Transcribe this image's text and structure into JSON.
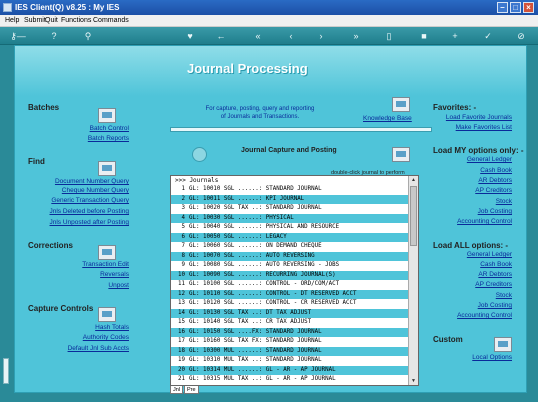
{
  "window": {
    "title": "IES Client(Q) v8.25 : My IES"
  },
  "menu": [
    "Help",
    "Submit",
    "Quit",
    "Functions",
    "Commands"
  ],
  "toolbar_icons": [
    "key-icon",
    "help-icon",
    "search-icon",
    "heart-icon",
    "back-icon",
    "first-icon",
    "prev-icon",
    "next-icon",
    "last-icon",
    "page-icon",
    "stop-icon",
    "add-icon",
    "ok-icon",
    "cancel-icon"
  ],
  "page": {
    "heading": "Journal Processing"
  },
  "batches": {
    "title": "Batches",
    "links": [
      "Batch Control",
      "Batch Reports"
    ]
  },
  "find": {
    "title": "Find",
    "links": [
      "Document Number Query",
      "Cheque Number Query",
      "Generic Transaction Query",
      "Jnls Deleted before Posting",
      "Jnls Unposted after Posting"
    ]
  },
  "corrections": {
    "title": "Corrections",
    "links": [
      "Transaction Edit",
      "Reversals",
      "Unpost"
    ]
  },
  "capture_controls": {
    "title": "Capture Controls",
    "links": [
      "Hash Totals",
      "Authority Codes",
      "Default Jnl Sub Accts"
    ]
  },
  "center": {
    "description_line1": "For capture, posting, query and reporting",
    "description_line2": "of Journals and Transactions.",
    "knowledge_base": "Knowledge Base",
    "capture_title": "Journal Capture and Posting",
    "capture_hint": "double-click journal to perform"
  },
  "journals": {
    "header": ">>> Journals",
    "rows": [
      "GL: 10010 SGL ......: STANDARD JOURNAL",
      "GL: 10011 SGL ......: KPI JOURNAL",
      "GL: 10020 SGL TAX ..: STANDARD JOURNAL",
      "GL: 10030 SGL ......: PHYSICAL",
      "GL: 10040 SGL ......: PHYSICAL AND RESOURCE",
      "GL: 10050 SGL ......: LEGACY",
      "GL: 10060 SGL ......: ON DEMAND CHEQUE",
      "GL: 10070 SGL ......: AUTO REVERSING",
      "GL: 10080 SGL ......: AUTO REVERSING - JOBS",
      "GL: 10090 SGL ......: RECURRING JOURNAL(S)",
      "GL: 10100 SGL ......: CONTROL - ORD/COM/ACT",
      "GL: 10110 SGL ......: CONTROL - DT RESERVED ACCT",
      "GL: 10120 SGL ......: CONTROL - CR RESERVED ACCT",
      "GL: 10130 SGL TAX ..: DT TAX ADJUST",
      "GL: 10140 SGL TAX ..: CR TAX ADJUST",
      "GL: 10150 SGL ....FX: STANDARD JOURNAL",
      "GL: 10160 SGL TAX FX: STANDARD JOURNAL",
      "GL: 10300 MUL ......: STANDARD JOURNAL",
      "GL: 10310 MUL TAX ..: STANDARD JOURNAL",
      "GL: 10314 MUL ......: GL - AR - AP JOURNAL",
      "GL: 10315 MUL TAX ..: GL - AR - AP JOURNAL"
    ],
    "tabs": [
      "Jnl",
      "Pre"
    ]
  },
  "favorites": {
    "title": "Favorites: -",
    "links": [
      "Load Favorite Journals",
      "Make Favorites List"
    ]
  },
  "my_options": {
    "title": "Load MY options only: -",
    "links": [
      "General Ledger",
      "Cash Book",
      "AR Debtors",
      "AP Creditors",
      "Stock",
      "Job Costing",
      "Accounting Control"
    ]
  },
  "all_options": {
    "title": "Load ALL options: -",
    "links": [
      "General Ledger",
      "Cash Book",
      "AR Debtors",
      "AP Creditors",
      "Stock",
      "Job Costing",
      "Accounting Control"
    ]
  },
  "custom": {
    "title": "Custom",
    "links": [
      "Local Options"
    ]
  },
  "colors": {
    "background": "#2a8a98",
    "frame": "#4fc4d9",
    "link": "#0a2a9a",
    "row_highlight": "#4fc4d9"
  }
}
